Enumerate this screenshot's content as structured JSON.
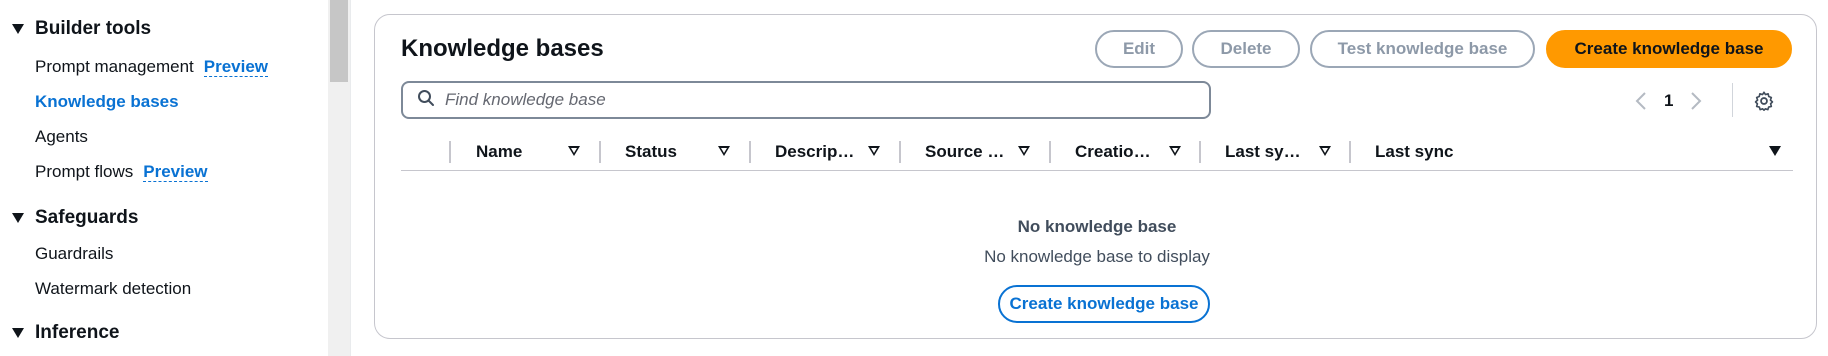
{
  "sidebar": {
    "sections": [
      {
        "label": "Builder tools"
      },
      {
        "label": "Safeguards"
      },
      {
        "label": "Inference"
      }
    ],
    "items": {
      "prompt_management": {
        "label": "Prompt management",
        "badge": "Preview"
      },
      "knowledge_bases": {
        "label": "Knowledge bases"
      },
      "agents": {
        "label": "Agents"
      },
      "prompt_flows": {
        "label": "Prompt flows",
        "badge": "Preview"
      },
      "guardrails": {
        "label": "Guardrails"
      },
      "watermark_detection": {
        "label": "Watermark detection"
      }
    }
  },
  "panel": {
    "title": "Knowledge bases",
    "buttons": {
      "edit": "Edit",
      "delete": "Delete",
      "test": "Test knowledge base",
      "create": "Create knowledge base"
    },
    "search": {
      "placeholder": "Find knowledge base",
      "value": ""
    },
    "pagination": {
      "current_page": "1"
    },
    "columns": [
      "Name",
      "Status",
      "Descrip…",
      "Source …",
      "Creatio…",
      "Last sy…",
      "Last sync"
    ],
    "empty_state": {
      "title": "No knowledge base",
      "description": "No knowledge base to display",
      "button": "Create knowledge base"
    }
  },
  "colors": {
    "accent": "#0972d3",
    "primary_button": "#ff9900",
    "disabled_border": "#9ba7b6"
  },
  "icons": {
    "search": "search-icon",
    "settings": "gear-icon",
    "prev": "chevron-left-icon",
    "next": "chevron-right-icon"
  }
}
